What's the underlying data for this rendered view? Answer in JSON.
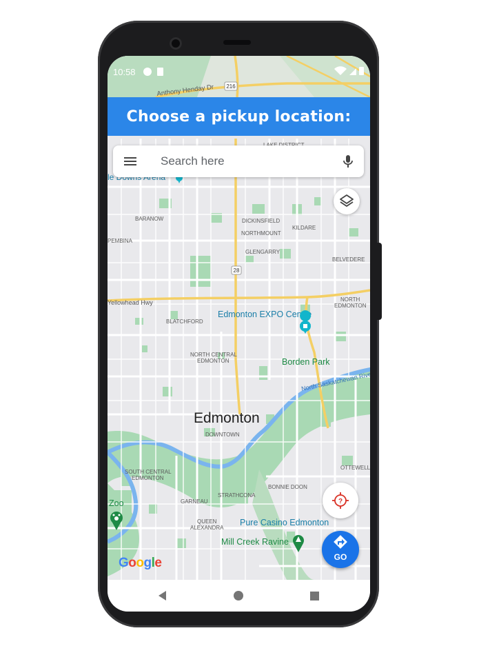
{
  "status_bar": {
    "time": "10:58"
  },
  "banner": {
    "text": "Choose a pickup location:",
    "color": "#2b86e8"
  },
  "search": {
    "placeholder": "Search here"
  },
  "map": {
    "roads": {
      "anthony_henday": "Anthony Henday Dr",
      "hwy_216": "216",
      "hwy_28": "28",
      "yellowhead": "Yellowhead Hwy"
    },
    "neighbourhoods": {
      "lake_district": "LAKE DISTRICT",
      "baranow": "BARANOW",
      "pembina": "PEMBINA",
      "dickinsfield": "DICKINSFIELD",
      "kildare": "KILDARE",
      "northmount": "NORTHMOUNT",
      "glengarry": "GLENGARRY",
      "belvedere": "BELVEDERE",
      "north_edmonton_1": "NORTH",
      "north_edmonton_2": "EDMONTON",
      "blatchford": "BLATCHFORD",
      "north_central_1": "NORTH CENTRAL",
      "north_central_2": "EDMONTON",
      "downtown": "DOWNTOWN",
      "south_central_1": "SOUTH CENTRAL",
      "south_central_2": "EDMONTON",
      "garneau": "GARNEAU",
      "strathcona": "STRATHCONA",
      "bonnie_doon": "BONNIE DOON",
      "ottewell": "OTTEWELL",
      "queen_alexandra_1": "QUEEN",
      "queen_alexandra_2": "ALEXANDRA"
    },
    "places": {
      "downs_arena": "le Downs Arena",
      "expo_centre": "Edmonton EXPO Centre",
      "borden_park": "Borden Park",
      "city": "Edmonton",
      "river": "North Saskatchewan Rive",
      "zoo": "Zoo",
      "pure_casino": "Pure Casino Edmonton",
      "mill_creek": "Mill Creek Ravine"
    },
    "colors": {
      "background": "#e9e9ec",
      "road": "#ffffff",
      "highway": "#f4cf64",
      "park": "#a9d9b4",
      "water": "#7ab4ee",
      "poi_blue": "#1a7ea8",
      "poi_green": "#1e8a45"
    }
  },
  "buttons": {
    "layers_icon": "layers-icon",
    "location_icon": "location-unknown-icon",
    "go_label": "GO",
    "go_color": "#1a73e8"
  },
  "attribution": {
    "logo_text": "Google"
  },
  "navigation": {
    "back": "back-triangle-icon",
    "home": "home-circle-icon",
    "recents": "recents-square-icon"
  }
}
